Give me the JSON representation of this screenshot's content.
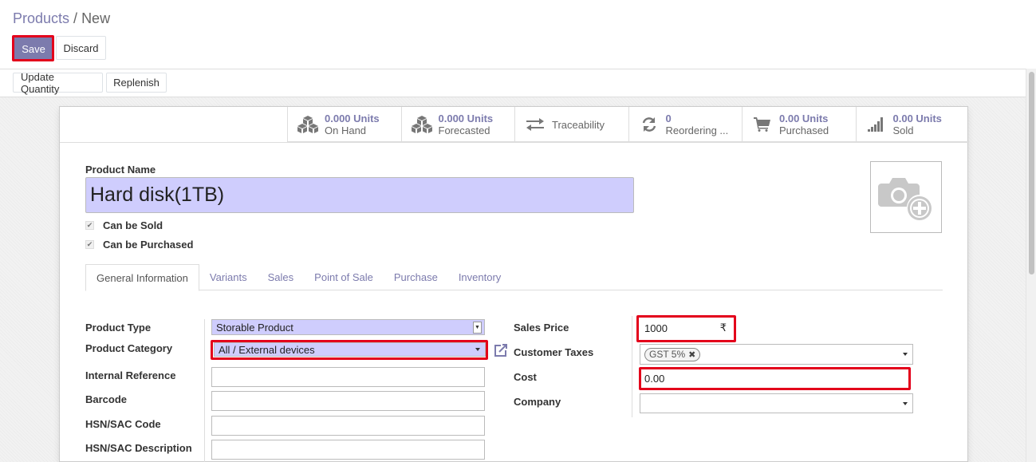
{
  "breadcrumb": {
    "parent": "Products",
    "separator": "/",
    "current": "New"
  },
  "toolbar": {
    "save_label": "Save",
    "discard_label": "Discard"
  },
  "actions": {
    "update_quantity_label": "Update Quantity",
    "replenish_label": "Replenish"
  },
  "stats": [
    {
      "icon": "cubes-icon",
      "value": "0.000 Units",
      "label": "On Hand"
    },
    {
      "icon": "cubes-icon",
      "value": "0.000 Units",
      "label": "Forecasted"
    },
    {
      "icon": "exchange-arrows-icon",
      "value": "",
      "label": "Traceability"
    },
    {
      "icon": "refresh-icon",
      "value": "0",
      "label": "Reordering ..."
    },
    {
      "icon": "shopping-cart-icon",
      "value": "0.00 Units",
      "label": "Purchased"
    },
    {
      "icon": "signal-bars-icon",
      "value": "0.00 Units",
      "label": "Sold"
    }
  ],
  "product": {
    "name_label": "Product Name",
    "name": "Hard disk(1TB)",
    "can_be_sold_label": "Can be Sold",
    "can_be_sold": true,
    "can_be_purchased_label": "Can be Purchased",
    "can_be_purchased": true,
    "image_icon": "camera-plus-icon"
  },
  "tabs": [
    {
      "label": "General Information",
      "active": true
    },
    {
      "label": "Variants",
      "active": false
    },
    {
      "label": "Sales",
      "active": false
    },
    {
      "label": "Point of Sale",
      "active": false
    },
    {
      "label": "Purchase",
      "active": false
    },
    {
      "label": "Inventory",
      "active": false
    }
  ],
  "left_fields": {
    "product_type": {
      "label": "Product Type",
      "value": "Storable Product"
    },
    "product_category": {
      "label": "Product Category",
      "value": "All / External devices"
    },
    "internal_reference": {
      "label": "Internal Reference",
      "value": ""
    },
    "barcode": {
      "label": "Barcode",
      "value": ""
    },
    "hsn_code": {
      "label": "HSN/SAC Code",
      "value": ""
    },
    "hsn_description": {
      "label": "HSN/SAC Description",
      "value": ""
    }
  },
  "right_fields": {
    "sales_price": {
      "label": "Sales Price",
      "value": "1000",
      "currency": "₹"
    },
    "customer_taxes": {
      "label": "Customer Taxes",
      "tags": [
        "GST 5%"
      ]
    },
    "cost": {
      "label": "Cost",
      "value": "0.00"
    },
    "company": {
      "label": "Company",
      "value": ""
    }
  },
  "colors": {
    "brand": "#7c7bad",
    "required_bg": "#cfcdfd",
    "highlight": "#e3001b"
  }
}
